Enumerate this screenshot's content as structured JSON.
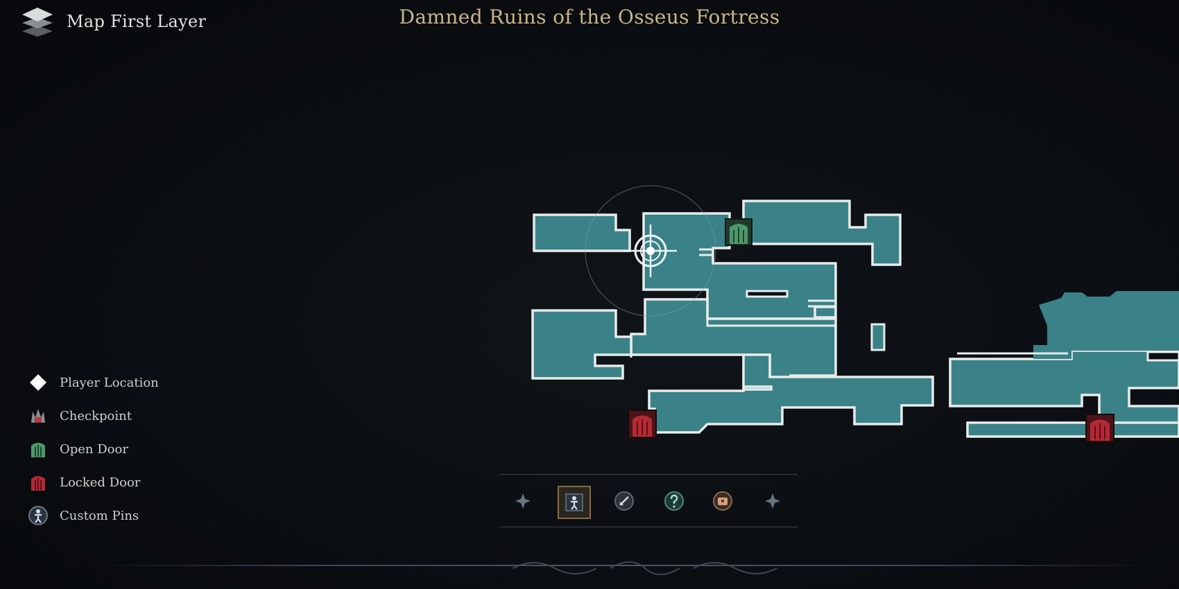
{
  "header": {
    "layer_label": "Map First Layer",
    "area_title": "Damned Ruins of the Osseus Fortress",
    "layer_icon": "stacked-layers-icon"
  },
  "legend": {
    "items": [
      {
        "label": "Player Location",
        "icon": "player-location-icon"
      },
      {
        "label": "Checkpoint",
        "icon": "checkpoint-icon"
      },
      {
        "label": "Open Door",
        "icon": "open-door-icon"
      },
      {
        "label": "Locked Door",
        "icon": "locked-door-icon"
      },
      {
        "label": "Custom Pins",
        "icon": "custom-pin-icon"
      }
    ]
  },
  "filter_bar": {
    "buttons": [
      {
        "icon": "prev-arrow-icon"
      },
      {
        "icon": "custom-pin-filter-icon",
        "selected": true
      },
      {
        "icon": "sword-icon"
      },
      {
        "icon": "question-mark-icon"
      },
      {
        "icon": "chest-icon"
      },
      {
        "icon": "next-arrow-icon"
      }
    ]
  },
  "map": {
    "markers": [
      {
        "type": "player-location"
      },
      {
        "type": "open-door"
      },
      {
        "type": "locked-door"
      },
      {
        "type": "locked-door"
      }
    ]
  },
  "colors": {
    "room_fill": "#3a8288",
    "room_wall": "#e8ecea",
    "open_door": "#4c9a6a",
    "locked_door": "#b42a34",
    "title_gold": "#c9b68a",
    "background": "#0b0e12"
  }
}
